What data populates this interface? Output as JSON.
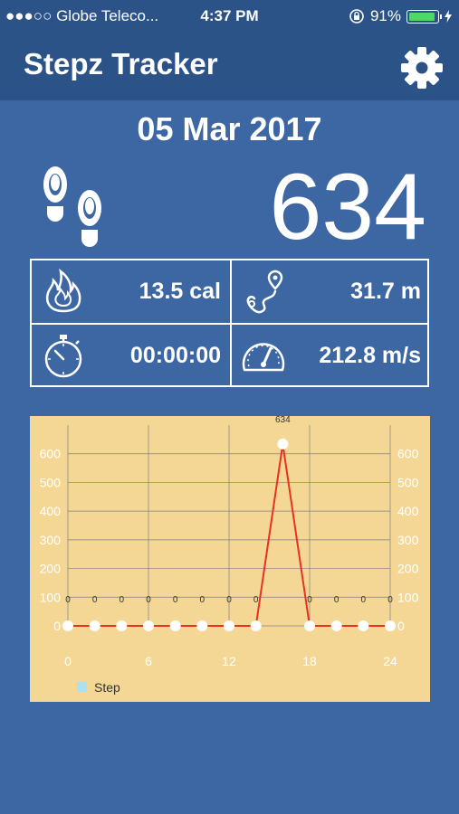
{
  "status_bar": {
    "carrier": "●●●○○ Globe Teleco...",
    "time": "4:37 PM",
    "battery_percent": "91%",
    "battery_level": 0.91,
    "icons": [
      "rotation-lock-icon",
      "battery-icon",
      "charging-bolt-icon"
    ]
  },
  "header": {
    "title": "Stepz Tracker",
    "settings_icon": "gear-icon"
  },
  "summary": {
    "date": "05 Mar 2017",
    "steps": "634",
    "steps_icon": "footprints-icon"
  },
  "stats": {
    "calories": "13.5 cal",
    "distance": "31.7 m",
    "duration": "00:00:00",
    "speed": "212.8 m/s",
    "icons": [
      "flame-icon",
      "route-icon",
      "stopwatch-icon",
      "speedometer-icon"
    ]
  },
  "colors": {
    "background": "#3d67a3",
    "bar": "#2c5388",
    "chart_background": "#f5d795",
    "line": "#e8321e",
    "legend_swatch": "#a8e2f5"
  },
  "chart_data": {
    "type": "line",
    "x": [
      0,
      2,
      4,
      6,
      8,
      10,
      12,
      14,
      16,
      18,
      20,
      22,
      24
    ],
    "series": [
      {
        "name": "Step",
        "values": [
          0,
          0,
          0,
          0,
          0,
          0,
          0,
          0,
          634,
          0,
          0,
          0,
          0
        ]
      }
    ],
    "value_labels": [
      "0",
      "0",
      "0",
      "0",
      "0",
      "0",
      "0",
      "0",
      "634",
      "0",
      "0",
      "0",
      "0"
    ],
    "xlim": [
      0,
      24
    ],
    "ylim": [
      0,
      700
    ],
    "x_ticks": [
      "0",
      "6",
      "12",
      "18",
      "24"
    ],
    "x_tick_values": [
      0,
      6,
      12,
      18,
      24
    ],
    "y_ticks": [
      "0",
      "100",
      "200",
      "300",
      "400",
      "500",
      "600"
    ],
    "y_tick_values": [
      0,
      100,
      200,
      300,
      400,
      500,
      600
    ],
    "legend": "bottom-left",
    "grid": true,
    "dual_y_axis": true
  }
}
